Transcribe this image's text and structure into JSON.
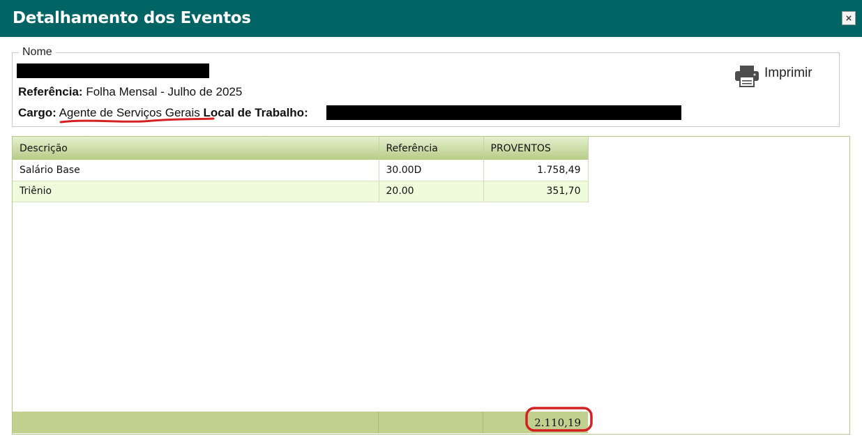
{
  "window": {
    "title": "Detalhamento dos Eventos",
    "close_symbol": "×"
  },
  "employee": {
    "group_legend": "Nome",
    "referencia_label": "Referência:",
    "referencia_value": "Folha Mensal - Julho de 2025",
    "cargo_label": "Cargo:",
    "cargo_value": "Agente de Serviços Gerais",
    "local_label": "Local de Trabalho:"
  },
  "print": {
    "label": "Imprimir",
    "icon": "printer-icon"
  },
  "table": {
    "headers": [
      "Descrição",
      "Referência",
      "PROVENTOS"
    ],
    "rows": [
      {
        "descricao": "Salário Base",
        "referencia": "30.00D",
        "proventos": "1.758,49"
      },
      {
        "descricao": "Triênio",
        "referencia": "20.00",
        "proventos": "351,70"
      }
    ],
    "total_proventos": "2.110,19"
  },
  "colors": {
    "header_bar": "#006464",
    "table_header": "#b6cb86",
    "alt_row": "#effbdb",
    "totals_row": "#c1d08f",
    "annotation": "#d42020"
  }
}
